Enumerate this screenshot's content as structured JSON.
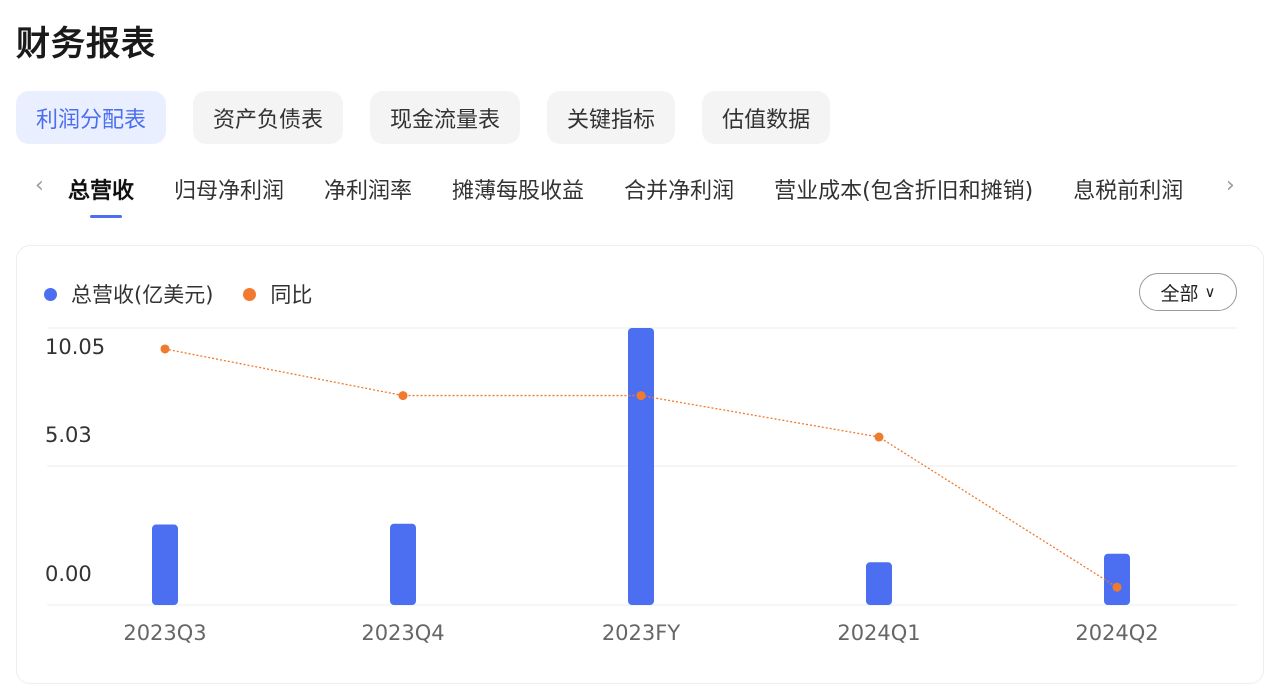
{
  "page": {
    "title": "财务报表"
  },
  "report_tabs": [
    {
      "label": "利润分配表",
      "active": true
    },
    {
      "label": "资产负债表",
      "active": false
    },
    {
      "label": "现金流量表",
      "active": false
    },
    {
      "label": "关键指标",
      "active": false
    },
    {
      "label": "估值数据",
      "active": false
    }
  ],
  "metric_nav": {
    "prev_icon": "chevron-left-icon",
    "next_icon": "chevron-right-icon"
  },
  "metric_tabs": [
    {
      "label": "总营收",
      "active": true
    },
    {
      "label": "归母净利润",
      "active": false
    },
    {
      "label": "净利润率",
      "active": false
    },
    {
      "label": "摊薄每股收益",
      "active": false
    },
    {
      "label": "合并净利润",
      "active": false
    },
    {
      "label": "营业成本(包含折旧和摊销)",
      "active": false
    },
    {
      "label": "息税前利润",
      "active": false
    }
  ],
  "legend": [
    {
      "label": "总营收(亿美元)",
      "color": "#4b6ff0"
    },
    {
      "label": "同比",
      "color": "#f07a2d"
    }
  ],
  "filter": {
    "selected": "全部"
  },
  "colors": {
    "bar": "#4b6ff0",
    "line": "#f07a2d",
    "accent": "#4b6ff0"
  },
  "chart_data": {
    "type": "bar",
    "categories": [
      "2023Q3",
      "2023Q4",
      "2023FY",
      "2024Q1",
      "2024Q2"
    ],
    "series": [
      {
        "name": "总营收(亿美元)",
        "type": "bar",
        "axis": "left",
        "values": [
          2.92,
          2.95,
          10.05,
          1.55,
          1.86
        ]
      },
      {
        "name": "同比",
        "type": "line",
        "axis": "right",
        "values": [
          0.95,
          0.77,
          0.77,
          0.61,
          0.03
        ]
      }
    ],
    "y_ticks": [
      "10.05",
      "5.03",
      "0.00"
    ],
    "ylim": [
      0,
      10.05
    ],
    "y2lim": [
      0,
      1
    ],
    "grid": true,
    "legend_position": "top-left"
  }
}
